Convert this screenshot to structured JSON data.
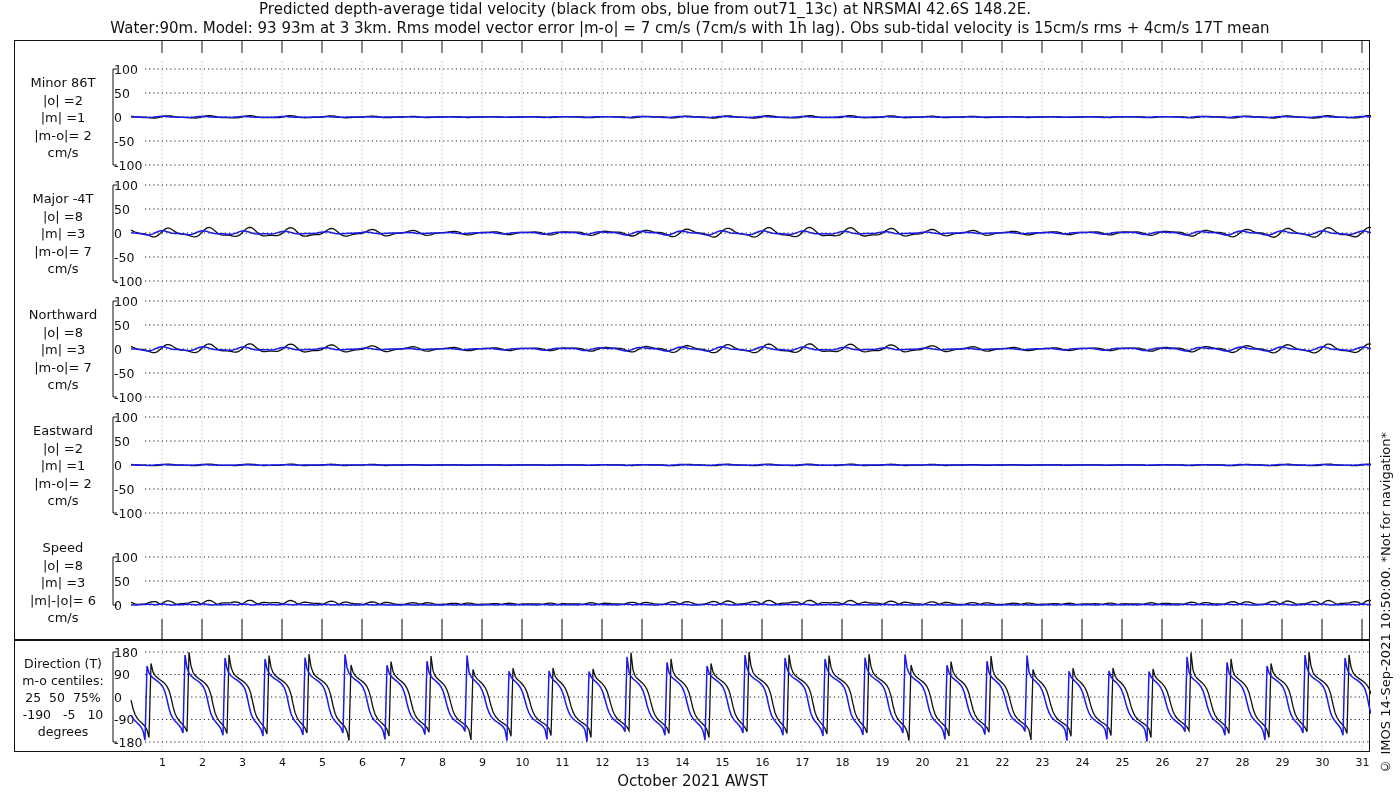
{
  "title": [
    "Predicted depth-average tidal velocity (black from obs, blue from out71_13c) at NRSMAI 42.6S 148.2E.",
    "Water:90m. Model: 93 93m at 3 3km. Rms model vector error |m-o| = 7 cm/s (7cm/s with 1h lag). Obs sub-tidal velocity is 15cm/s rms + 4cm/s 17T mean"
  ],
  "panels": [
    {
      "kind": "velocity",
      "label": [
        "Minor 86T",
        "|o| =2",
        "|m| =1",
        "|m-o|= 2",
        "cm/s"
      ],
      "yticks": [
        "100",
        "50",
        "0",
        "-50",
        "-100"
      ]
    },
    {
      "kind": "velocity",
      "label": [
        "Major -4T",
        "|o| =8",
        "|m| =3",
        "|m-o|= 7",
        "cm/s"
      ],
      "yticks": [
        "100",
        "50",
        "0",
        "-50",
        "-100"
      ]
    },
    {
      "kind": "velocity",
      "label": [
        "Northward",
        "|o| =8",
        "|m| =3",
        "|m-o|= 7",
        "cm/s"
      ],
      "yticks": [
        "100",
        "50",
        "0",
        "-50",
        "-100"
      ]
    },
    {
      "kind": "velocity",
      "label": [
        "Eastward",
        "|o| =2",
        "|m| =1",
        "|m-o|= 2",
        "cm/s"
      ],
      "yticks": [
        "100",
        "50",
        "0",
        "-50",
        "-100"
      ]
    },
    {
      "kind": "speed",
      "label": [
        "Speed",
        "|o| =8",
        "|m| =3",
        "|m|-|o|= 6",
        "cm/s"
      ],
      "yticks": [
        "100",
        "50",
        "0"
      ]
    },
    {
      "kind": "direction",
      "label": [
        "Direction (T)",
        "m-o centiles:",
        "25  50  75%",
        "-190   -5   10",
        "degrees"
      ],
      "yticks": [
        "180",
        "90",
        "0",
        "-90",
        "-180"
      ]
    }
  ],
  "x_axis": {
    "ticks": [
      "1",
      "2",
      "3",
      "4",
      "5",
      "6",
      "7",
      "8",
      "9",
      "10",
      "11",
      "12",
      "13",
      "14",
      "15",
      "16",
      "17",
      "18",
      "19",
      "20",
      "21",
      "22",
      "23",
      "24",
      "25",
      "26",
      "27",
      "28",
      "29",
      "30",
      "31"
    ],
    "label": "October 2021 AWST"
  },
  "credit": "© IMOS 14-Sep-2021 10:50:00. *Not for navigation*"
}
